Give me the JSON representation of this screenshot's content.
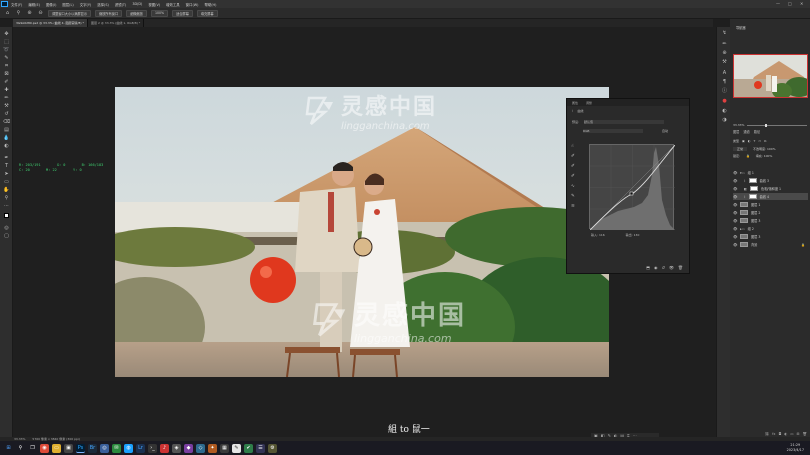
{
  "app": {
    "menu": [
      "文件(F)",
      "编辑(E)",
      "图像(I)",
      "图层(L)",
      "文字(Y)",
      "选择(S)",
      "滤镜(T)",
      "3D(D)",
      "视图(V)",
      "增效工具",
      "窗口(W)",
      "帮助(H)"
    ],
    "window_controls": [
      "—",
      "□",
      "✕"
    ]
  },
  "options_bar": {
    "home_icon": "home-icon",
    "zoom_icon": "zoom-icon",
    "resize_windows": "调整窗口大小以满屏显示",
    "zoom_all": "缩放所有窗口",
    "scrubby_zoom": "细微缩放",
    "zoom_value": "100%",
    "fit_screen": "适合屏幕",
    "fill_screen": "填充屏幕"
  },
  "doc_tabs": [
    {
      "label": "3G9A0280.psd @ 33.3% (曲线 4, 图层蒙版/8) *",
      "active": true
    },
    {
      "label": "图层 2 @ 33.3% (曲线 1, RGB/8) *",
      "active": false
    }
  ],
  "info_overlay": {
    "row1": [
      "R: 203/191",
      "G: 0",
      "B: 166/183"
    ],
    "row2": [
      "C: 20",
      "M: 22",
      "Y: 0"
    ]
  },
  "watermark": {
    "cn": "灵感中国",
    "en": "lingganchina.com"
  },
  "subtitle": "組 to 鼠一",
  "curves_panel": {
    "tab1": "属性",
    "tab2": "调整",
    "title": "曲线",
    "preset_label": "预设:",
    "preset_value": "默认值",
    "channel": "RGB",
    "auto": "自动",
    "input_label": "输入: 116",
    "output_label": "输出: 130"
  },
  "right_panel": {
    "navigator_tab": "导航器",
    "layers_tabs": [
      "图层",
      "通道",
      "路径"
    ],
    "kind_label": "类型",
    "blend_mode": "正常",
    "opacity": "不透明度: 100%",
    "lock_label": "锁定:",
    "fill": "填充: 100%",
    "layers": [
      {
        "name": "组 1",
        "type": "group",
        "selected": false
      },
      {
        "name": "曲线 3",
        "type": "adjust",
        "selected": false
      },
      {
        "name": "色相/饱和度 1",
        "type": "adjust",
        "selected": false
      },
      {
        "name": "曲线 4",
        "type": "adjust",
        "selected": true
      },
      {
        "name": "图层 1",
        "type": "pixel",
        "selected": false
      },
      {
        "name": "图层 2",
        "type": "pixel",
        "selected": false
      },
      {
        "name": "图层 3",
        "type": "pixel",
        "selected": false
      },
      {
        "name": "组 2",
        "type": "group",
        "selected": false
      },
      {
        "name": "图层 3",
        "type": "pixel",
        "selected": false
      },
      {
        "name": "背景",
        "type": "pixel",
        "selected": false
      }
    ]
  },
  "status_bar": {
    "zoom": "33.33%",
    "doc_info": "5760 像素 x 3840 像素 (300 ppi)"
  },
  "taskbar": {
    "time": "21:29",
    "date": "2023/4/17",
    "icons": [
      "windows-icon",
      "search-icon",
      "chrome-icon",
      "folder-icon",
      "photoshop-icon",
      "bridge-icon",
      "lightroom-icon",
      "wechat-icon",
      "qq-icon",
      "browser-icon",
      "terminal-icon",
      "music-icon"
    ]
  },
  "colors": {
    "ps_blue": "#31a8ff",
    "overlay_green": "#3fd070",
    "selected_layer": "#4a4a4a"
  }
}
